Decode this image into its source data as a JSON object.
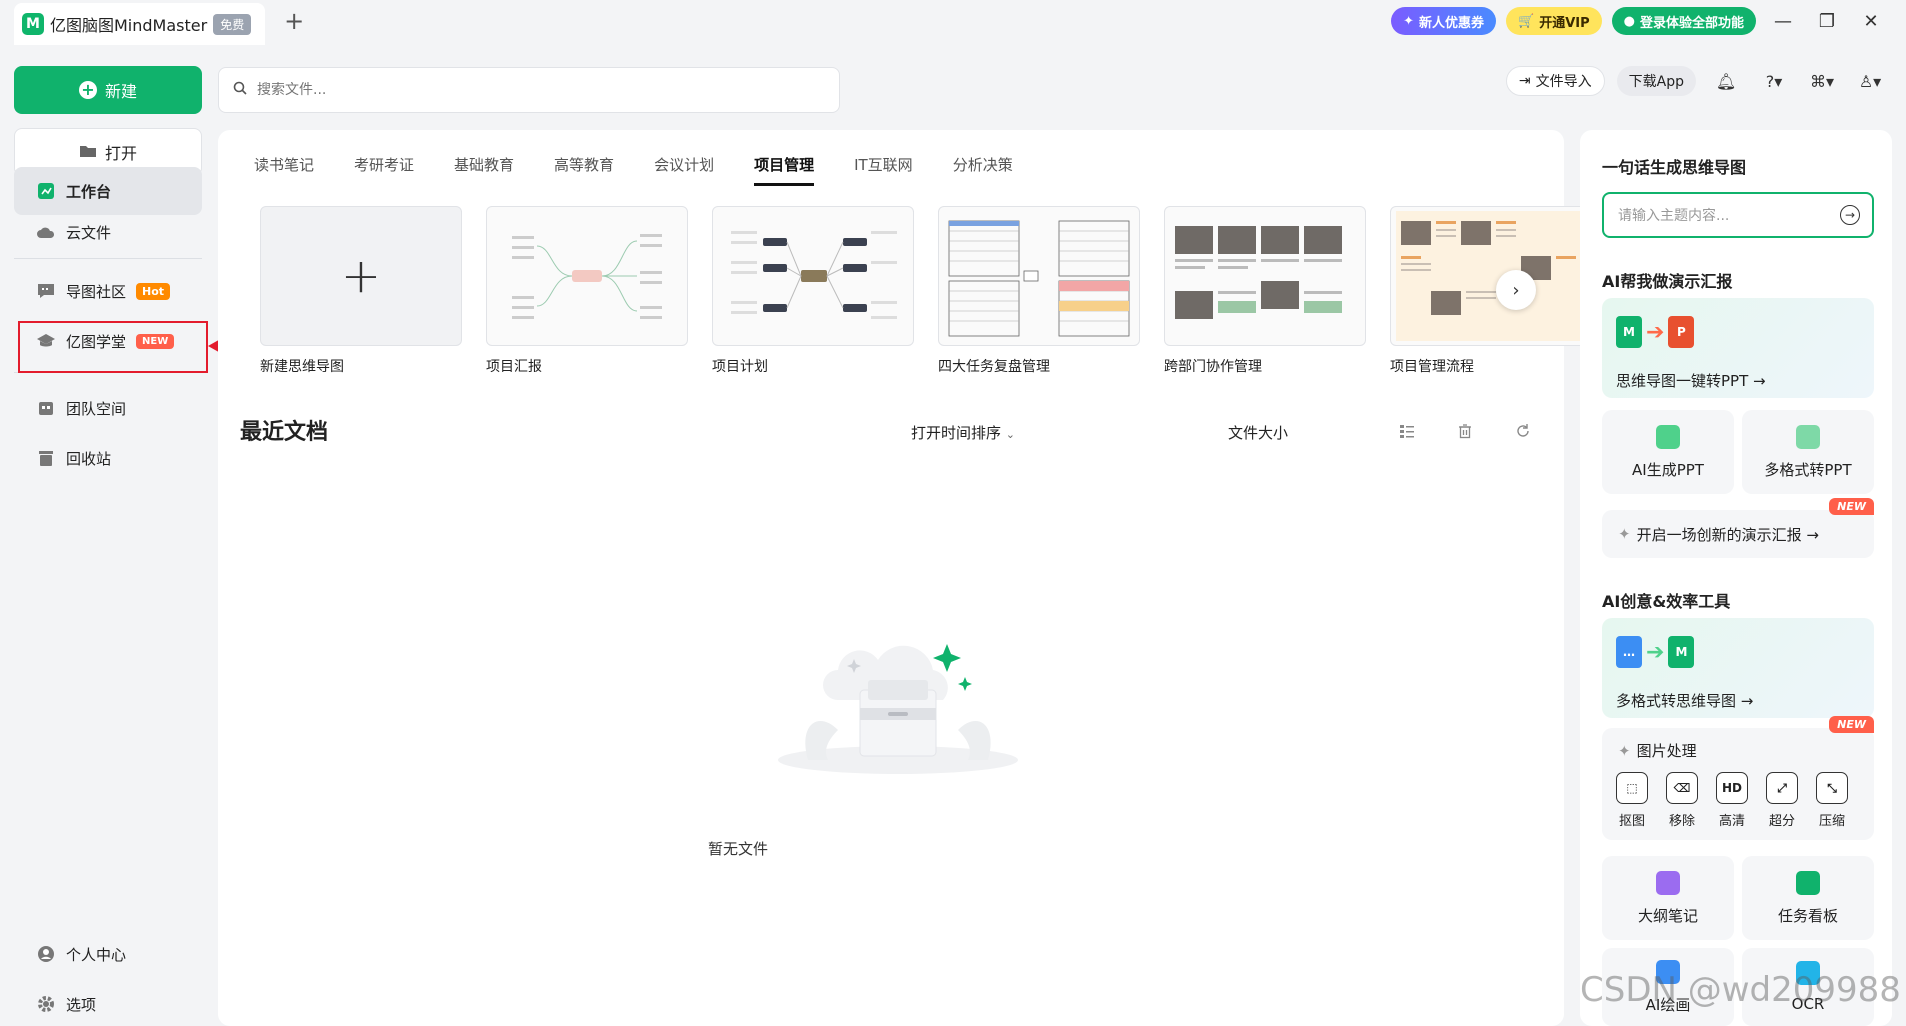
{
  "titlebar": {
    "app_name": "亿图脑图MindMaster",
    "free_badge": "免费",
    "new_tab": "+",
    "coupon": "新人优惠券",
    "vip": "开通VIP",
    "login": "登录体验全部功能"
  },
  "sidebar": {
    "new_label": "新建",
    "open_label": "打开",
    "items": [
      {
        "label": "工作台"
      },
      {
        "label": "云文件"
      },
      {
        "label": "导图社区",
        "badge": "Hot"
      },
      {
        "label": "亿图学堂",
        "badge": "NEW"
      },
      {
        "label": "团队空间"
      },
      {
        "label": "回收站"
      },
      {
        "label": "个人中心"
      },
      {
        "label": "选项"
      }
    ]
  },
  "search": {
    "placeholder": "搜索文件..."
  },
  "top_actions": {
    "import": "文件导入",
    "download": "下载App"
  },
  "tabs": [
    "读书笔记",
    "考研考证",
    "基础教育",
    "高等教育",
    "会议计划",
    "项目管理",
    "IT互联网",
    "分析决策"
  ],
  "templates": [
    "新建思维导图",
    "项目汇报",
    "项目计划",
    "四大任务复盘管理",
    "跨部门协作管理",
    "项目管理流程"
  ],
  "recent": {
    "title": "最近文档",
    "sort": "打开时间排序",
    "size": "文件大小",
    "empty": "暂无文件"
  },
  "right": {
    "gen_title": "一句话生成思维导图",
    "gen_placeholder": "请输入主题内容...",
    "ai_report_title": "AI帮我做演示汇报",
    "mm_to_ppt": "思维导图一键转PPT →",
    "ai_ppt": "AI生成PPT",
    "multi_ppt": "多格式转PPT",
    "new_badge": "NEW",
    "innovate": "开启一场创新的演示汇报 →",
    "tools_title": "AI创意&效率工具",
    "multi_mm": "多格式转思维导图 →",
    "img_title": "图片处理",
    "img_tools": [
      "抠图",
      "移除",
      "高清",
      "超分",
      "压缩"
    ],
    "hd_text": "HD",
    "outline": "大纲笔记",
    "task": "任务看板",
    "ai_draw": "AI绘画",
    "ocr": "OCR"
  },
  "watermark": "CSDN @wd209988",
  "colors": {
    "brand": "#10b26c",
    "highlight": "#e31c2d",
    "hot": "#ff8a00",
    "new": "#ff5f4a"
  }
}
